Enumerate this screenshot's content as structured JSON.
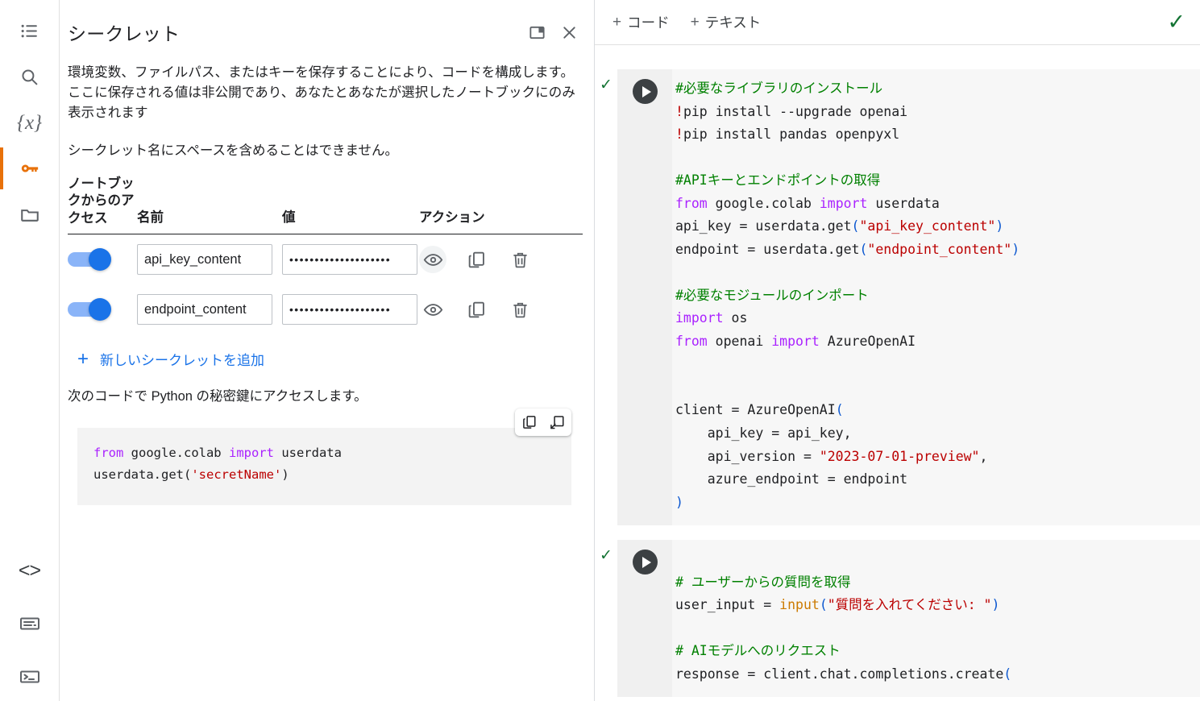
{
  "rail": {
    "top_items": [
      {
        "name": "table-of-contents-icon",
        "label": "目次"
      },
      {
        "name": "search-icon",
        "label": "検索"
      },
      {
        "name": "variables-icon",
        "label": "{x}"
      },
      {
        "name": "key-icon",
        "label": "シークレット",
        "active": true
      },
      {
        "name": "folder-icon",
        "label": "ファイル"
      }
    ],
    "bottom_items": [
      {
        "name": "code-snippets-icon",
        "label": "<>"
      },
      {
        "name": "command-palette-icon",
        "label": "コマンド"
      },
      {
        "name": "terminal-icon",
        "label": "ターミナル"
      }
    ],
    "active_color": "#e8710a"
  },
  "panel": {
    "title": "シークレット",
    "buttons": {
      "dock": "ドッキング",
      "close": "閉じる"
    },
    "description": "環境変数、ファイルパス、またはキーを保存することにより、コードを構成します。ここに保存される値は非公開であり、あなたとあなたが選択したノートブックにのみ表示されます",
    "note": "シークレット名にスペースを含めることはできません。",
    "table": {
      "headers": {
        "access": "ノートブックからのアクセス",
        "name": "名前",
        "value": "値",
        "action": "アクション"
      },
      "rows": [
        {
          "enabled": true,
          "name": "api_key_content",
          "value_masked": "••••••••••••••••••••",
          "actions": [
            "visibility-icon",
            "copy-icon",
            "delete-icon"
          ]
        },
        {
          "enabled": true,
          "name": "endpoint_content",
          "value_masked": "••••••••••••••••••••",
          "actions": [
            "visibility-icon",
            "copy-icon",
            "delete-icon"
          ]
        }
      ]
    },
    "add_secret_label": "新しいシークレットを追加",
    "snippet_intro": "次のコードで Python の秘密鍵にアクセスします。",
    "snippet": {
      "line1_kw1": "from",
      "line1_mod": " google.colab ",
      "line1_kw2": "import",
      "line1_tail": " userdata",
      "line2_head": "userdata.get(",
      "line2_str": "'secretName'",
      "line2_tail": ")"
    },
    "snippet_tools": [
      "copy-icon",
      "insert-in-notebook-icon"
    ]
  },
  "notebook": {
    "toolbar": {
      "add_code": "コード",
      "add_text": "テキスト",
      "plus": "+",
      "status_check": "✓"
    },
    "cells": [
      {
        "status": "✓",
        "run_label": "セルを実行",
        "lines": [
          [
            {
              "t": "#必要なライブラリのインストール",
              "c": "cmt"
            }
          ],
          [
            {
              "t": "!",
              "c": "num"
            },
            {
              "t": "pip install --upgrade openai",
              "c": ""
            }
          ],
          [
            {
              "t": "!",
              "c": "num"
            },
            {
              "t": "pip install pandas openpyxl",
              "c": ""
            }
          ],
          [],
          [
            {
              "t": "#APIキーとエンドポイントの取得",
              "c": "cmt"
            }
          ],
          [
            {
              "t": "from",
              "c": "kw"
            },
            {
              "t": " google.colab ",
              "c": ""
            },
            {
              "t": "import",
              "c": "kw"
            },
            {
              "t": " userdata",
              "c": ""
            }
          ],
          [
            {
              "t": "api_key = userdata.get",
              "c": ""
            },
            {
              "t": "(",
              "c": "par"
            },
            {
              "t": "\"api_key_content\"",
              "c": "str"
            },
            {
              "t": ")",
              "c": "par"
            }
          ],
          [
            {
              "t": "endpoint = userdata.get",
              "c": ""
            },
            {
              "t": "(",
              "c": "par"
            },
            {
              "t": "\"endpoint_content\"",
              "c": "str"
            },
            {
              "t": ")",
              "c": "par"
            }
          ],
          [],
          [
            {
              "t": "#必要なモジュールのインポート",
              "c": "cmt"
            }
          ],
          [
            {
              "t": "import",
              "c": "kw"
            },
            {
              "t": " os",
              "c": ""
            }
          ],
          [
            {
              "t": "from",
              "c": "kw"
            },
            {
              "t": " openai ",
              "c": ""
            },
            {
              "t": "import",
              "c": "kw"
            },
            {
              "t": " AzureOpenAI",
              "c": ""
            }
          ],
          [],
          [],
          [
            {
              "t": "client = AzureOpenAI",
              "c": ""
            },
            {
              "t": "(",
              "c": "par"
            }
          ],
          [
            {
              "t": "    api_key = api_key,",
              "c": ""
            }
          ],
          [
            {
              "t": "    api_version = ",
              "c": ""
            },
            {
              "t": "\"2023-07-01-preview\"",
              "c": "str"
            },
            {
              "t": ",",
              "c": ""
            }
          ],
          [
            {
              "t": "    azure_endpoint = endpoint",
              "c": ""
            }
          ],
          [
            {
              "t": ")",
              "c": "par"
            }
          ]
        ]
      },
      {
        "status": "✓",
        "run_label": "セルを実行",
        "lines": [
          [],
          [
            {
              "t": "# ユーザーからの質問を取得",
              "c": "cmt"
            }
          ],
          [
            {
              "t": "user_input = ",
              "c": ""
            },
            {
              "t": "input",
              "c": "fn"
            },
            {
              "t": "(",
              "c": "par"
            },
            {
              "t": "\"質問を入れてください: \"",
              "c": "str"
            },
            {
              "t": ")",
              "c": "par"
            }
          ],
          [],
          [
            {
              "t": "# AIモデルへのリクエスト",
              "c": "cmt"
            }
          ],
          [
            {
              "t": "response = client.chat.completions.create",
              "c": ""
            },
            {
              "t": "(",
              "c": "par"
            }
          ]
        ]
      }
    ]
  },
  "colors": {
    "accent_orange": "#e8710a",
    "link_blue": "#1a73e8",
    "toggle_track": "#8ab4f8",
    "check_green": "#137333",
    "comment_green": "#008000",
    "string_red": "#bb0000",
    "keyword_purple": "#aa22ff"
  }
}
